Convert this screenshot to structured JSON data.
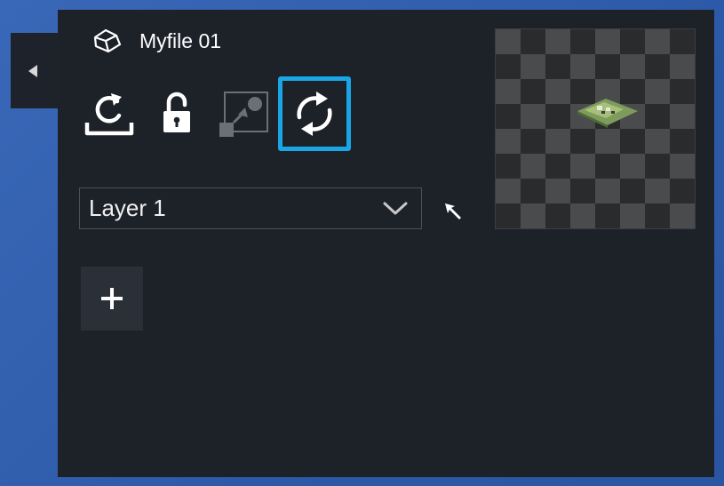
{
  "file": {
    "name": "Myfile 01"
  },
  "toolbar": {
    "tools": [
      {
        "icon": "refresh-upload-icon",
        "state": "enabled"
      },
      {
        "icon": "unlock-icon",
        "state": "enabled"
      },
      {
        "icon": "resize-object-icon",
        "state": "disabled"
      },
      {
        "icon": "sync-icon",
        "state": "selected"
      }
    ]
  },
  "layer_select": {
    "value": "Layer 1",
    "icon": "chevron-down-icon"
  },
  "pointer": {
    "icon": "pointer-arrow-icon"
  },
  "add_button": {
    "label": "+"
  },
  "preview": {
    "icon": "map-thumbnail"
  },
  "colors": {
    "panel": "#1d2128",
    "accent": "#1aa6e6",
    "background": "#2d5aa8",
    "disabled": "#6b6f76"
  }
}
